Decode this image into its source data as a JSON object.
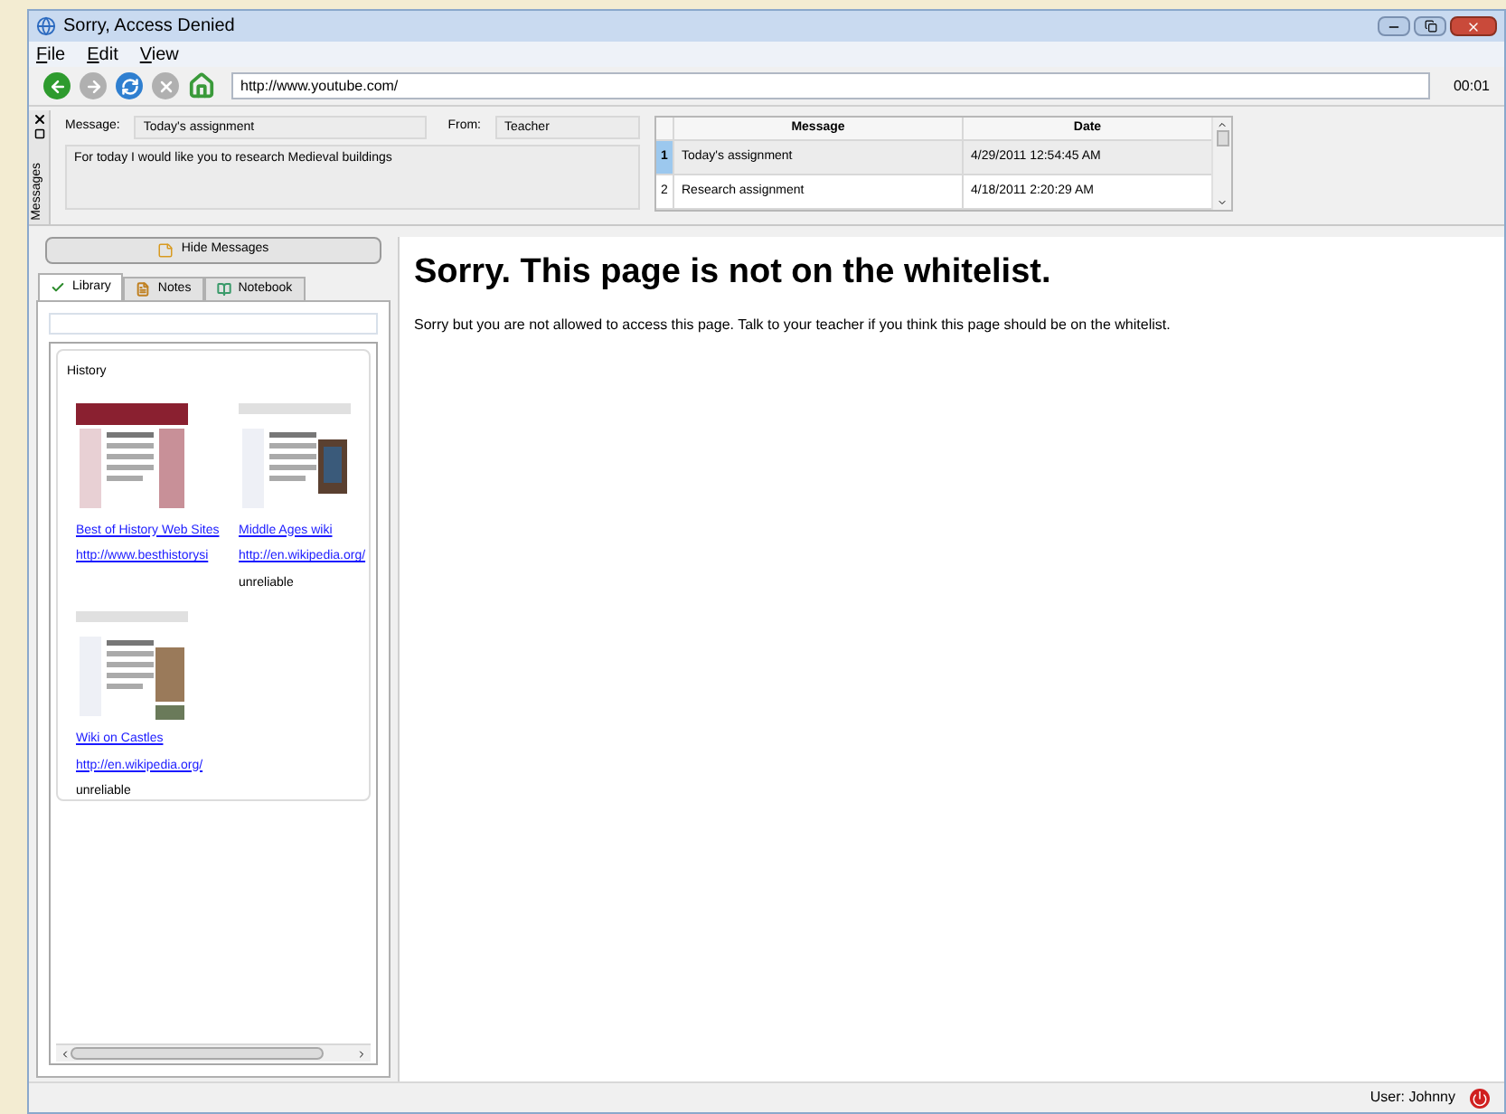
{
  "window": {
    "title": "Sorry, Access Denied"
  },
  "menu": [
    "File",
    "Edit",
    "View"
  ],
  "toolbar": {
    "buttons": [
      {
        "kind": "back",
        "disabled": false
      },
      {
        "kind": "forward",
        "disabled": true
      },
      {
        "kind": "refresh",
        "disabled": false
      },
      {
        "kind": "stop",
        "disabled": true
      },
      {
        "kind": "home",
        "disabled": false
      }
    ],
    "address": "http://www.youtube.com/",
    "timer": "00:01"
  },
  "messages_panel": {
    "title": "Messages",
    "message_label": "Message:",
    "message": "Today's assignment",
    "from_label": "From:",
    "from": "Teacher",
    "body": "For today I would like you to research Medieval buildings",
    "table": {
      "columns": [
        "Message",
        "Date"
      ],
      "rows": [
        {
          "number": "1",
          "message": "Today's assignment",
          "date": "4/29/2011 12:54:45 AM",
          "selected": true
        },
        {
          "number": "2",
          "message": "Research assignment",
          "date": "4/18/2011 2:20:29 AM",
          "selected": false
        }
      ]
    }
  },
  "hide_button": "Hide Messages",
  "tabs": [
    {
      "label": "Library",
      "kind": "library",
      "selected": true
    },
    {
      "label": "Notes",
      "kind": "notes",
      "selected": false
    },
    {
      "label": "Notebook",
      "kind": "notebook",
      "selected": false
    }
  ],
  "history": {
    "title": "History",
    "items": [
      {
        "title": "Best of History Web Sites",
        "url": "http://www.besthistorysi"
      },
      {
        "title": "Middle Ages wiki",
        "url": "http://en.wikipedia.org/",
        "note": "unreliable"
      },
      {
        "title": "Wiki on Castles",
        "url": "http://en.wikipedia.org/",
        "note": "unreliable"
      }
    ]
  },
  "content": {
    "heading": "Sorry. This page is not on the whitelist.",
    "text": "Sorry but you are not allowed to access this page. Talk to your teacher if you think this page should be on the whitelist."
  },
  "status_bar": {
    "user": "User: Johnny"
  }
}
